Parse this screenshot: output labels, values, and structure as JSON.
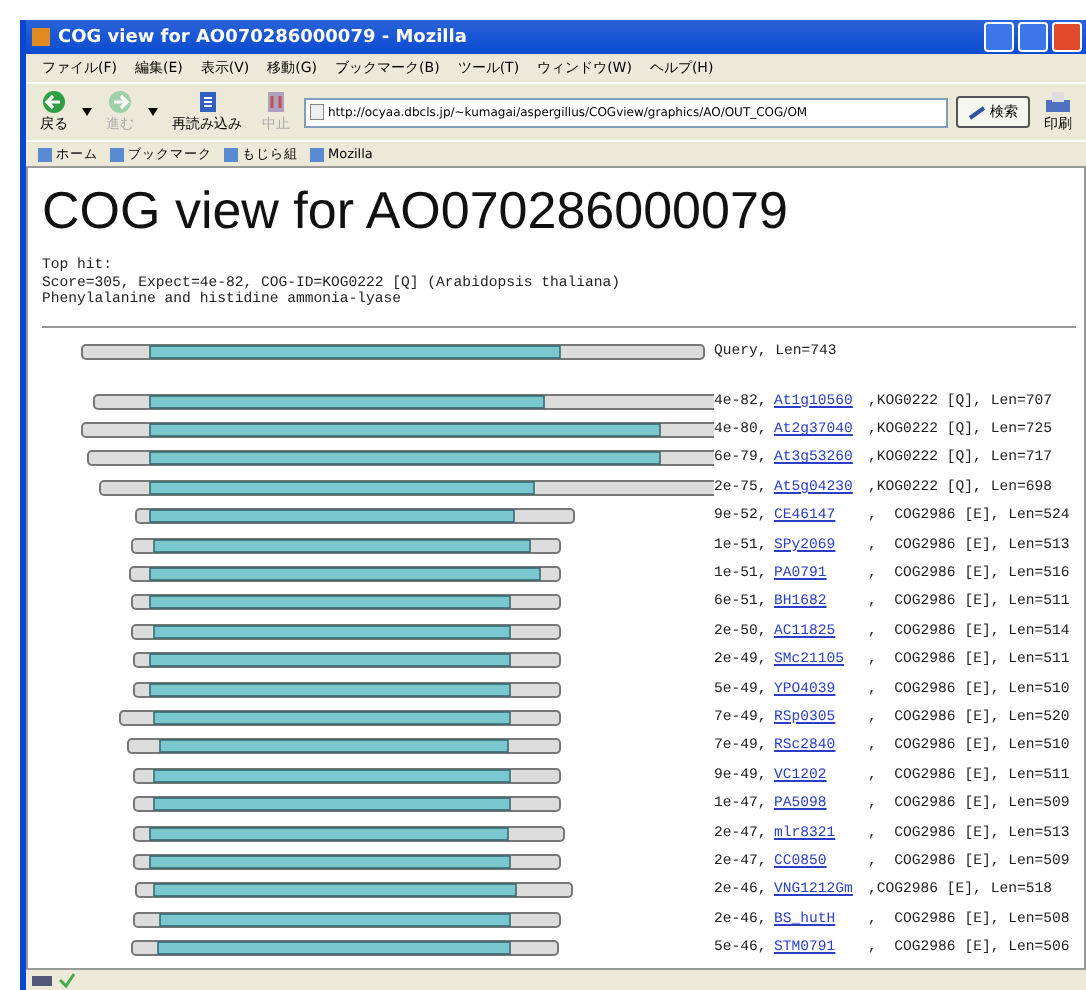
{
  "window": {
    "title": "COG view for AO070286000079 - Mozilla"
  },
  "menu": [
    "ファイル(F)",
    "編集(E)",
    "表示(V)",
    "移動(G)",
    "ブックマーク(B)",
    "ツール(T)",
    "ウィンドウ(W)",
    "ヘルプ(H)"
  ],
  "toolbar": [
    {
      "kind": "back",
      "label": "戻る",
      "disabled": false
    },
    {
      "kind": "forward",
      "label": "進む",
      "disabled": true
    },
    {
      "kind": "reload",
      "label": "再読み込み",
      "disabled": false
    },
    {
      "kind": "stop",
      "label": "中止",
      "disabled": true
    }
  ],
  "address": {
    "value": "http://ocyaa.dbcls.jp/~kumagai/aspergillus/COGview/graphics/AO/OUT_COG/OM"
  },
  "search_button": "検索",
  "print_button": "印刷",
  "bookmarks": [
    "ホーム",
    "ブックマーク",
    "もじら組",
    "Mozilla"
  ],
  "page": {
    "heading": "COG view for AO070286000079",
    "top_hit_label": "Top hit:",
    "top_hit_score": "Score=305, Expect=4e-82, COG-ID=KOG0222 [Q] (Arabidopsis thaliana)",
    "top_hit_name": "Phenylalanine and histidine ammonia-lyase",
    "query_label": "Query, Len=743"
  },
  "hits": [
    {
      "evalue": "4e-82,",
      "id": "At1g10560",
      "cog": ",KOG0222",
      "category": "[Q],",
      "length": "Len=707"
    },
    {
      "evalue": "4e-80,",
      "id": "At2g37040",
      "cog": ",KOG0222",
      "category": "[Q],",
      "length": "Len=725"
    },
    {
      "evalue": "6e-79,",
      "id": "At3g53260",
      "cog": ",KOG0222",
      "category": "[Q],",
      "length": "Len=717"
    },
    {
      "evalue": "2e-75,",
      "id": "At5g04230",
      "cog": ",KOG0222",
      "category": "[Q],",
      "length": "Len=698"
    },
    {
      "evalue": "9e-52,",
      "id": "CE46147",
      "cog": ",  COG2986",
      "category": "[E],",
      "length": "Len=524"
    },
    {
      "evalue": "1e-51,",
      "id": "SPy2069",
      "cog": ",  COG2986",
      "category": "[E],",
      "length": "Len=513"
    },
    {
      "evalue": "1e-51,",
      "id": "PA0791",
      "cog": ",  COG2986",
      "category": "[E],",
      "length": "Len=516"
    },
    {
      "evalue": "6e-51,",
      "id": "BH1682",
      "cog": ",  COG2986",
      "category": "[E],",
      "length": "Len=511"
    },
    {
      "evalue": "2e-50,",
      "id": "AC11825",
      "cog": ",  COG2986",
      "category": "[E],",
      "length": "Len=514"
    },
    {
      "evalue": "2e-49,",
      "id": "SMc21105",
      "cog": ",  COG2986",
      "category": "[E],",
      "length": "Len=511"
    },
    {
      "evalue": "5e-49,",
      "id": "YPO4039",
      "cog": ",  COG2986",
      "category": "[E],",
      "length": "Len=510"
    },
    {
      "evalue": "7e-49,",
      "id": "RSp0305",
      "cog": ",  COG2986",
      "category": "[E],",
      "length": "Len=520"
    },
    {
      "evalue": "7e-49,",
      "id": "RSc2840",
      "cog": ",  COG2986",
      "category": "[E],",
      "length": "Len=510"
    },
    {
      "evalue": "9e-49,",
      "id": "VC1202",
      "cog": ",  COG2986",
      "category": "[E],",
      "length": "Len=511"
    },
    {
      "evalue": "1e-47,",
      "id": "PA5098",
      "cog": ",  COG2986",
      "category": "[E],",
      "length": "Len=509"
    },
    {
      "evalue": "2e-47,",
      "id": "mlr8321",
      "cog": ",  COG2986",
      "category": "[E],",
      "length": "Len=513"
    },
    {
      "evalue": "2e-47,",
      "id": "CC0850",
      "cog": ",  COG2986",
      "category": "[E],",
      "length": "Len=509"
    },
    {
      "evalue": "2e-46,",
      "id": "VNG1212Gm",
      "cog": ",COG2986",
      "category": "[E],",
      "length": "Len=518"
    },
    {
      "evalue": "2e-46,",
      "id": "BS_hutH",
      "cog": ",  COG2986",
      "category": "[E],",
      "length": "Len=508"
    },
    {
      "evalue": "5e-46,",
      "id": "STM0791",
      "cog": ",  COG2986",
      "category": "[E],",
      "length": "Len=506"
    }
  ]
}
